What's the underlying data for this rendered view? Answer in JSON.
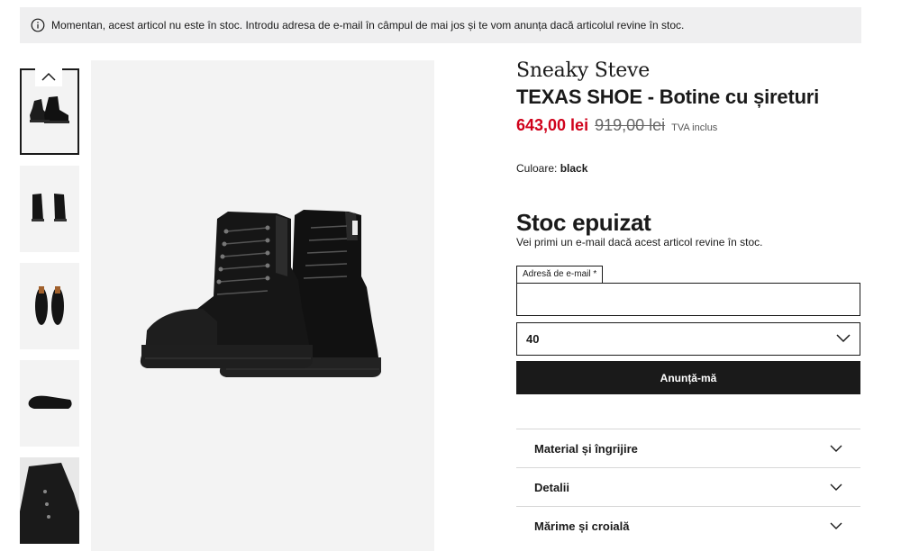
{
  "notice": {
    "icon": "info-icon",
    "text": "Momentan, acest articol nu este în stoc. Introdu adresa de e-mail în câmpul de mai jos și te vom anunța dacă articolul revine în stoc."
  },
  "gallery": {
    "thumbnails": [
      "boots-pair-side",
      "boots-pair-back",
      "boots-pair-top",
      "boot-sole",
      "boot-closeup"
    ],
    "active_index": 0,
    "up_icon": "chevron-up-icon"
  },
  "product": {
    "brand": "Sneaky Steve",
    "title": "TEXAS SHOE - Botine cu șireturi",
    "price_current": "643,00 lei",
    "price_old": "919,00 lei",
    "vat_note": "TVA inclus",
    "color_label": "Culoare:",
    "color_value": "black"
  },
  "stock": {
    "title": "Stoc epuizat",
    "subtitle": "Vei primi un e-mail dacă acest articol revine în stoc."
  },
  "form": {
    "email_label": "Adresă de e-mail",
    "required_mark": "*",
    "email_value": "",
    "size_value": "40",
    "notify_label": "Anunță-mă"
  },
  "accordion": [
    {
      "label": "Material și îngrijire"
    },
    {
      "label": "Detalii"
    },
    {
      "label": "Mărime și croială"
    }
  ],
  "colors": {
    "price_sale": "#d0021b",
    "button_bg": "#1a1a1a",
    "notice_bg": "#efeff0",
    "image_bg": "#f3f3f3"
  }
}
